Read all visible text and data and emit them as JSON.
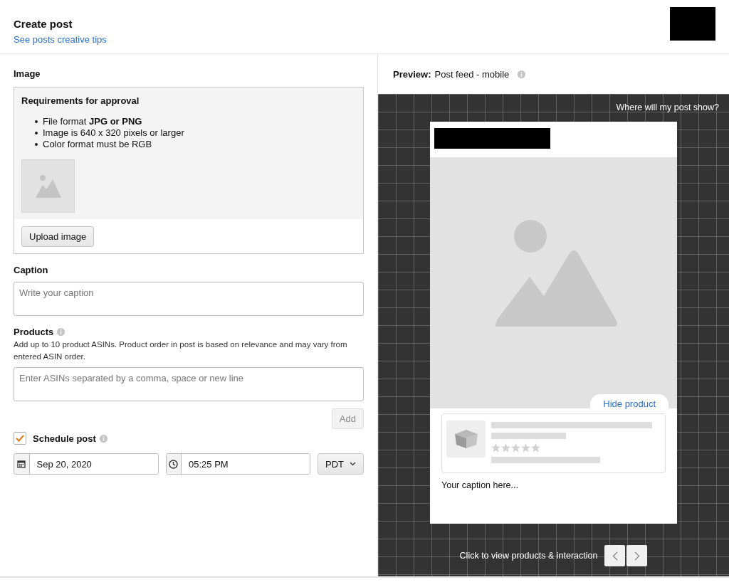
{
  "header": {
    "title": "Create post",
    "link": "See posts creative tips"
  },
  "image_section": {
    "label": "Image",
    "requirements_title": "Requirements for approval",
    "requirements": [
      "File format **JPG or PNG**",
      "Image is 640 x 320 pixels or larger",
      "Color format must be RGB"
    ],
    "upload_button": "Upload image"
  },
  "caption": {
    "label": "Caption",
    "placeholder": "Write your caption"
  },
  "products": {
    "label": "Products",
    "help": "Add up to 10 product ASINs. Product order in post is based on relevance and may vary from entered ASIN order.",
    "placeholder": "Enter ASINs separated by a comma, space or new line",
    "add_button": "Add",
    "add_disabled": true
  },
  "schedule": {
    "label": "Schedule post",
    "checked": true,
    "date": "Sep 20, 2020",
    "time": "05:25 PM",
    "timezone": "PDT"
  },
  "preview": {
    "label": "Preview:",
    "mode": "Post feed - mobile",
    "where_link": "Where will my post show?",
    "hide_product": "Hide product",
    "caption_placeholder": "Your caption here...",
    "footer": "Click to view products & interaction"
  }
}
